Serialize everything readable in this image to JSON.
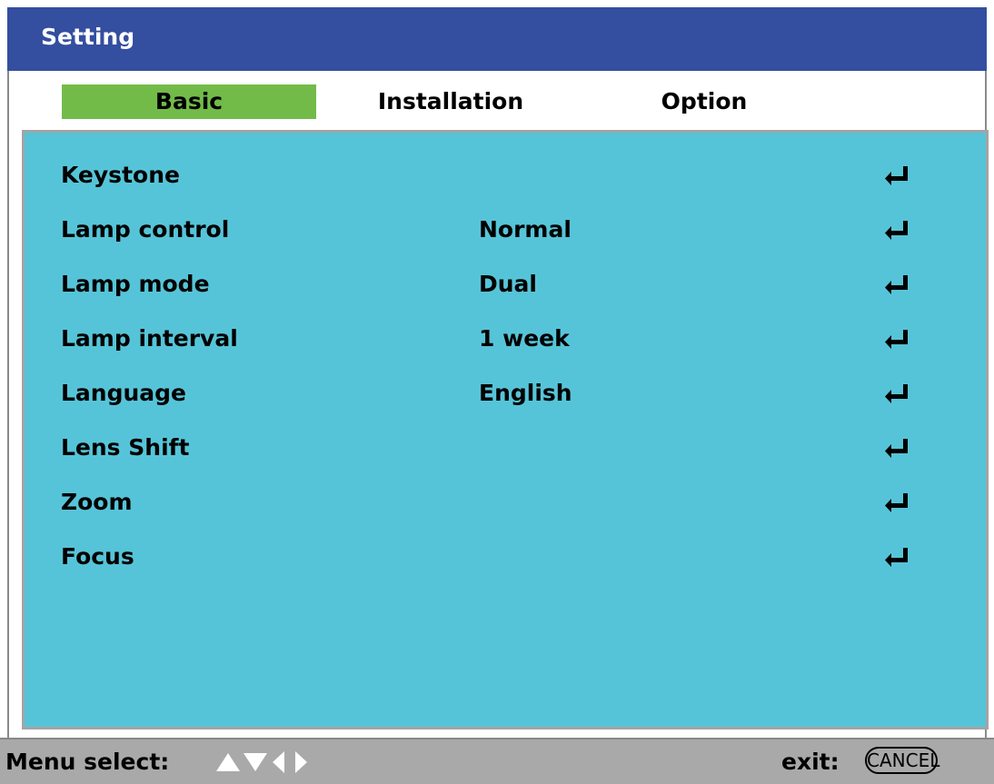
{
  "window": {
    "title": "Setting"
  },
  "tabs": [
    {
      "label": "Basic",
      "active": true
    },
    {
      "label": "Installation",
      "active": false
    },
    {
      "label": "Option",
      "active": false
    }
  ],
  "items": [
    {
      "label": "Keystone",
      "value": ""
    },
    {
      "label": "Lamp control",
      "value": "Normal"
    },
    {
      "label": "Lamp mode",
      "value": "Dual"
    },
    {
      "label": "Lamp interval",
      "value": "1 week"
    },
    {
      "label": "Language",
      "value": "English"
    },
    {
      "label": "Lens Shift",
      "value": ""
    },
    {
      "label": "Zoom",
      "value": ""
    },
    {
      "label": "Focus",
      "value": ""
    }
  ],
  "footer": {
    "menu_select_label": "Menu select:",
    "exit_label": "exit:",
    "cancel_label": "CANCEL"
  },
  "icons": {
    "enter": "enter-icon",
    "nav": [
      "arrow-up-icon",
      "arrow-down-icon",
      "arrow-left-icon",
      "arrow-right-icon"
    ]
  },
  "colors": {
    "title_bar": "#344ea0",
    "active_tab": "#72bb48",
    "panel": "#56c4d8",
    "status_bar": "#a9a9a9"
  }
}
